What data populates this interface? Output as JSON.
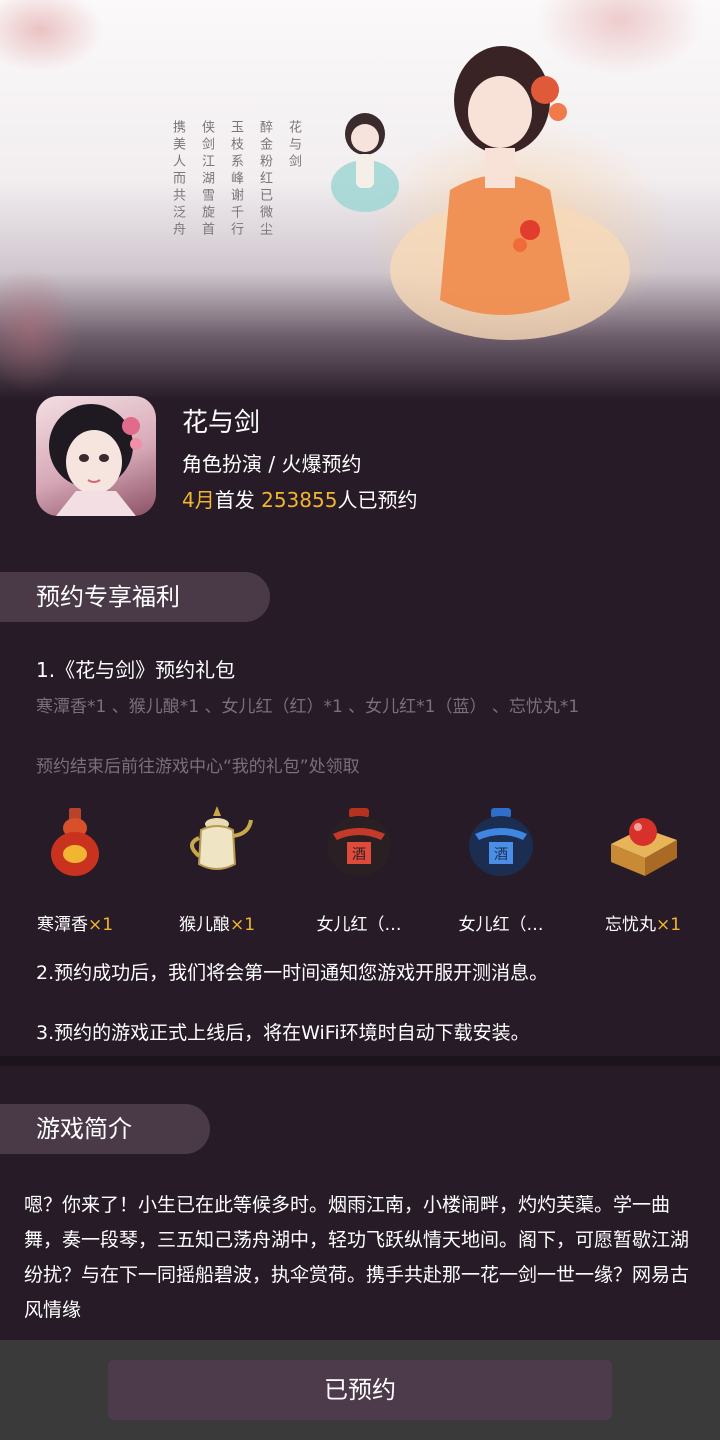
{
  "hero": {
    "calligraphy_lines": [
      "花与剑",
      "醉金粉红已微尘",
      "玉枝系峰谢千行",
      "侠剑江湖雪旋首",
      "携美人而共泛舟"
    ]
  },
  "app": {
    "name": "花与剑",
    "category": "角色扮演 / 火爆预约",
    "release": "4月",
    "release_suffix": "首发",
    "reservation_count": "253855",
    "reservation_suffix": "人已预约"
  },
  "benefits": {
    "title": "预约专享福利",
    "gift_heading": "1.《花与剑》预约礼包",
    "gift_items": "寒潭香*1 、猴儿酿*1 、女儿红（红）*1 、女儿红*1（蓝） 、忘忧丸*1",
    "gift_claim": "预约结束后前往游戏中心“我的礼包”处领取",
    "gifts": [
      {
        "name": "寒潭香",
        "qty": "×1",
        "icon": "red-gourd-bottle-icon"
      },
      {
        "name": "猴儿酿",
        "qty": "×1",
        "icon": "wine-teapot-icon"
      },
      {
        "name": "女儿红（…",
        "qty": "",
        "icon": "red-wine-jar-icon"
      },
      {
        "name": "女儿红（…",
        "qty": "",
        "icon": "blue-wine-jar-icon"
      },
      {
        "name": "忘忧丸",
        "qty": "×1",
        "icon": "pill-box-icon"
      }
    ],
    "note2": "2.预约成功后，我们将会第一时间通知您游戏开服开测消息。",
    "note3": "3.预约的游戏正式上线后，将在WiFi环境时自动下载安装。"
  },
  "intro": {
    "title": "游戏简介",
    "text": "嗯？你来了！小生已在此等候多时。烟雨江南，小楼闹畔，灼灼芙蕖。学一曲舞，奏一段琴，三五知己荡舟湖中，轻功飞跃纵情天地间。阁下，可愿暂歇江湖纷扰？与在下一同摇船碧波，执伞赏荷。携手共赴那一花一剑一世一缘？网易古风情缘"
  },
  "footer": {
    "button_label": "已预约"
  },
  "colors": {
    "background": "#261b26",
    "accent_gold": "#f2b531",
    "pill": "#4a3a48",
    "button": "#4d3a4b",
    "bottom_bar": "#3a3a3a"
  }
}
